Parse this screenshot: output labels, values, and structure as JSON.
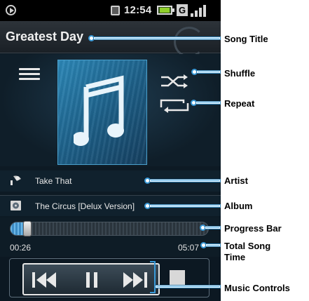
{
  "status_bar": {
    "time": "12:54",
    "network_label": "G"
  },
  "player": {
    "song_title": "Greatest Day",
    "artist": "Take That",
    "album": "The Circus [Delux Version]",
    "elapsed_time": "00:26",
    "total_time": "05:07",
    "progress_fraction": 0.085
  },
  "callouts": {
    "song_title": "Song Title",
    "shuffle": "Shuffle",
    "repeat": "Repeat",
    "artist": "Artist",
    "album": "Album",
    "progress_bar": "Progress Bar",
    "total_song_time_line1": "Total Song",
    "total_song_time_line2": "Time",
    "music_controls": "Music Controls"
  },
  "colors": {
    "accent_blue": "#3a9ad8",
    "callout_text": "#000000",
    "screen_bg": "#0d1a24"
  },
  "icons": [
    "play-notification-icon",
    "sd-card-icon",
    "battery-icon",
    "signal-icon",
    "menu-icon",
    "music-note-icon",
    "shuffle-icon",
    "repeat-icon",
    "artist-icon",
    "album-icon",
    "previous-icon",
    "pause-icon",
    "next-icon",
    "stop-icon"
  ]
}
